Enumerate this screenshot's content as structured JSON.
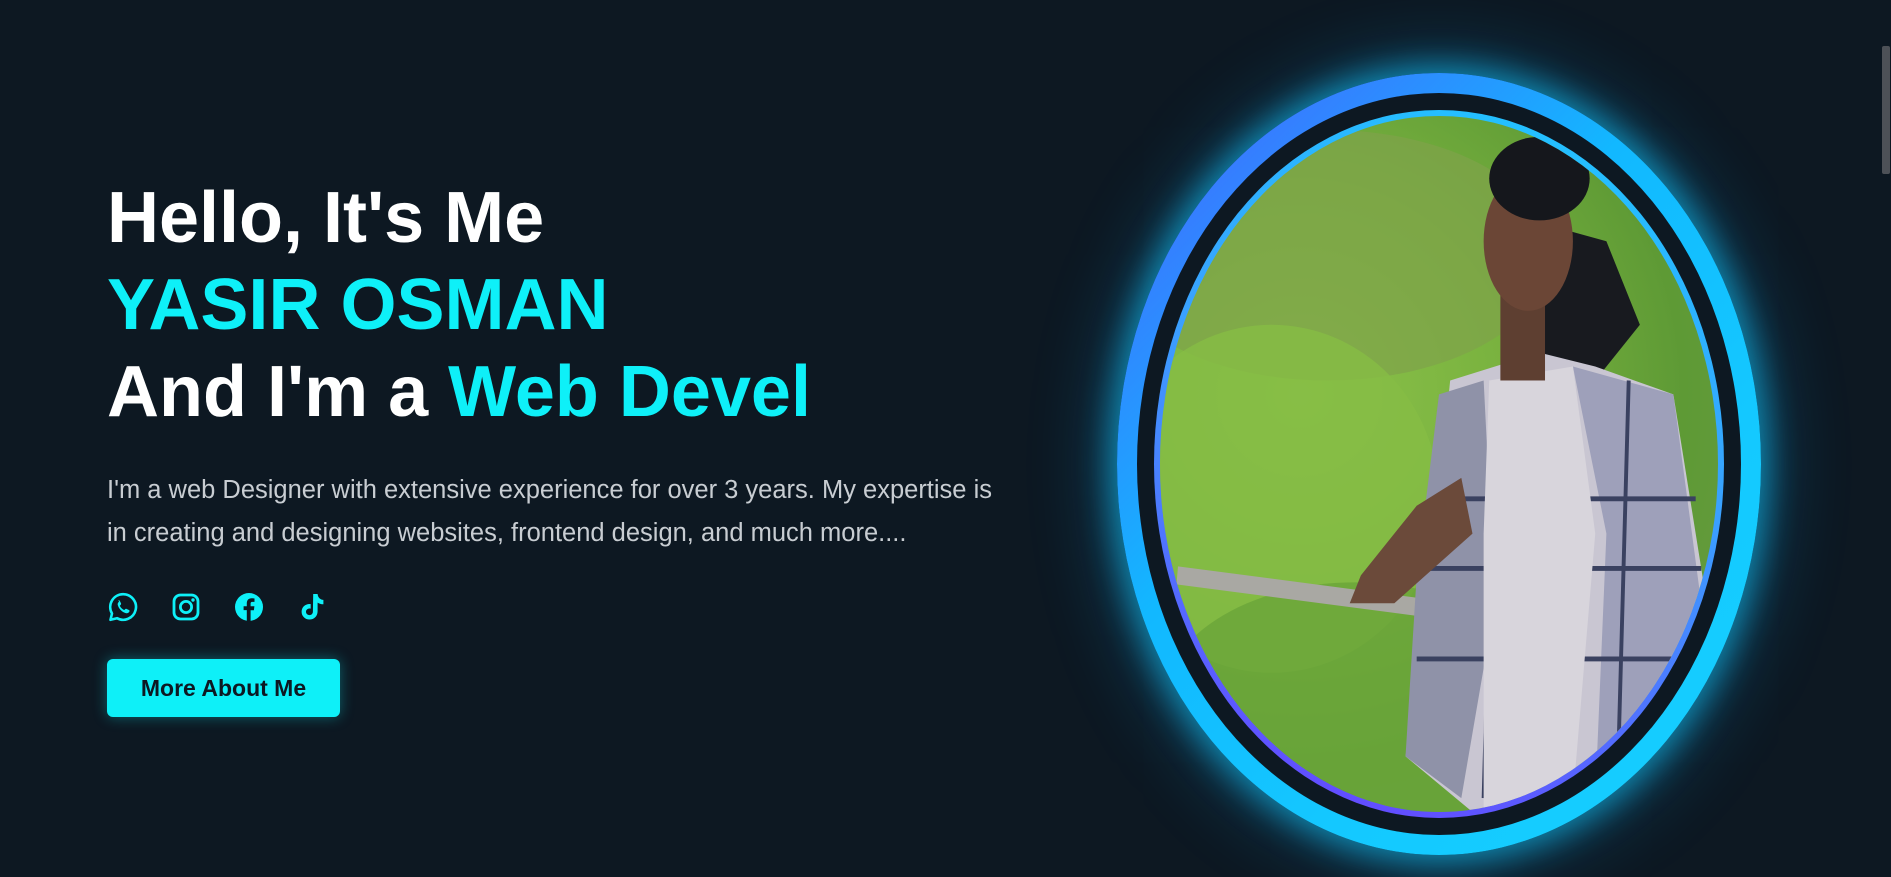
{
  "hero": {
    "greeting": "Hello, It's Me",
    "name": "YASIR OSMAN",
    "role_prefix": "And I'm a ",
    "role_typed": "Web Devel",
    "bio": "I'm a web Designer with extensive experience for over 3 years. My expertise is in creating and designing websites, frontend design, and much more....",
    "cta_label": "More About Me"
  },
  "socials": [
    {
      "icon": "whatsapp-icon"
    },
    {
      "icon": "instagram-icon"
    },
    {
      "icon": "facebook-icon"
    },
    {
      "icon": "tiktok-icon"
    }
  ],
  "colors": {
    "background": "#0d1822",
    "accent": "#0ef0f8",
    "text": "#ffffff",
    "muted_text": "#c8cdd2",
    "ring_start": "#4a5cff",
    "ring_end": "#16d0ff"
  }
}
